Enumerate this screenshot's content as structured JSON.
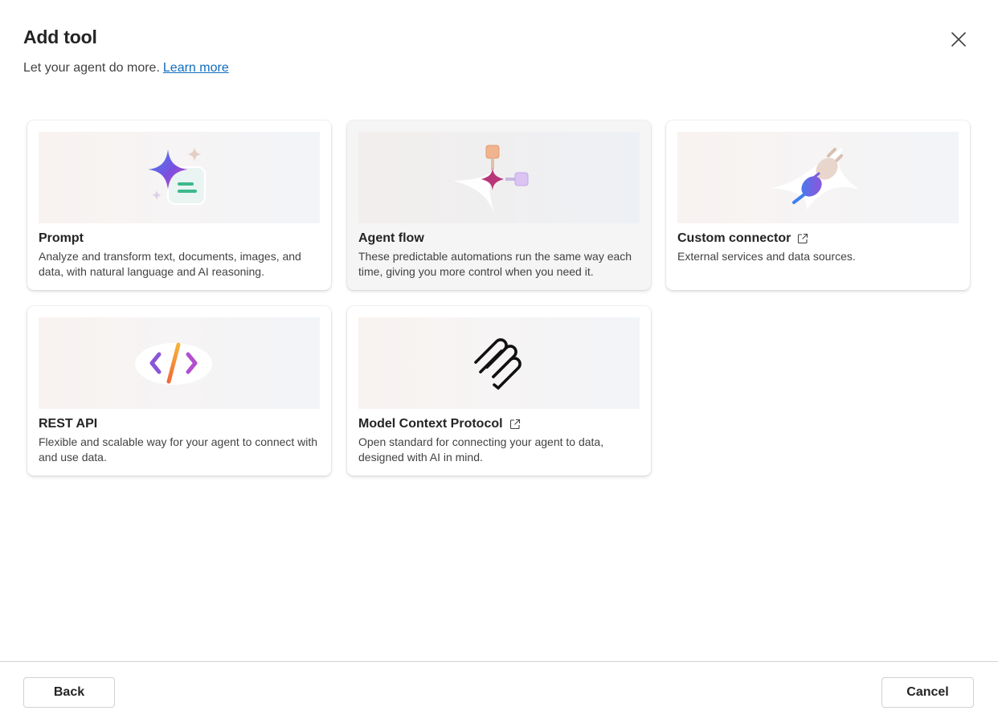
{
  "dialog": {
    "title": "Add tool",
    "subtitle": "Let your agent do more.",
    "learn_more": "Learn more",
    "close_icon": "close-icon"
  },
  "cards": [
    {
      "name": "Prompt",
      "description": "Analyze and transform text, documents, images, and data, with natural language and AI reasoning.",
      "icon": "prompt-sparkle-icon",
      "external": false
    },
    {
      "name": "Agent flow",
      "description": "These predictable automations run the same way each time, giving you more control when you need it.",
      "icon": "agent-flow-icon",
      "external": false,
      "hovered": true
    },
    {
      "name": "Custom connector",
      "description": "External services and data sources.",
      "icon": "plug-icon",
      "external": true
    },
    {
      "name": "REST API",
      "description": "Flexible and scalable way for your agent to connect with and use data.",
      "icon": "code-icon",
      "external": false
    },
    {
      "name": "Model Context Protocol",
      "description": "Open standard for connecting your agent to data, designed with AI in mind.",
      "icon": "mcp-icon",
      "external": true
    }
  ],
  "footer": {
    "back_label": "Back",
    "cancel_label": "Cancel"
  },
  "colors": {
    "link": "#0f6cbd",
    "text": "#242424",
    "secondary_text": "#424242",
    "border": "#d1d1d1"
  }
}
